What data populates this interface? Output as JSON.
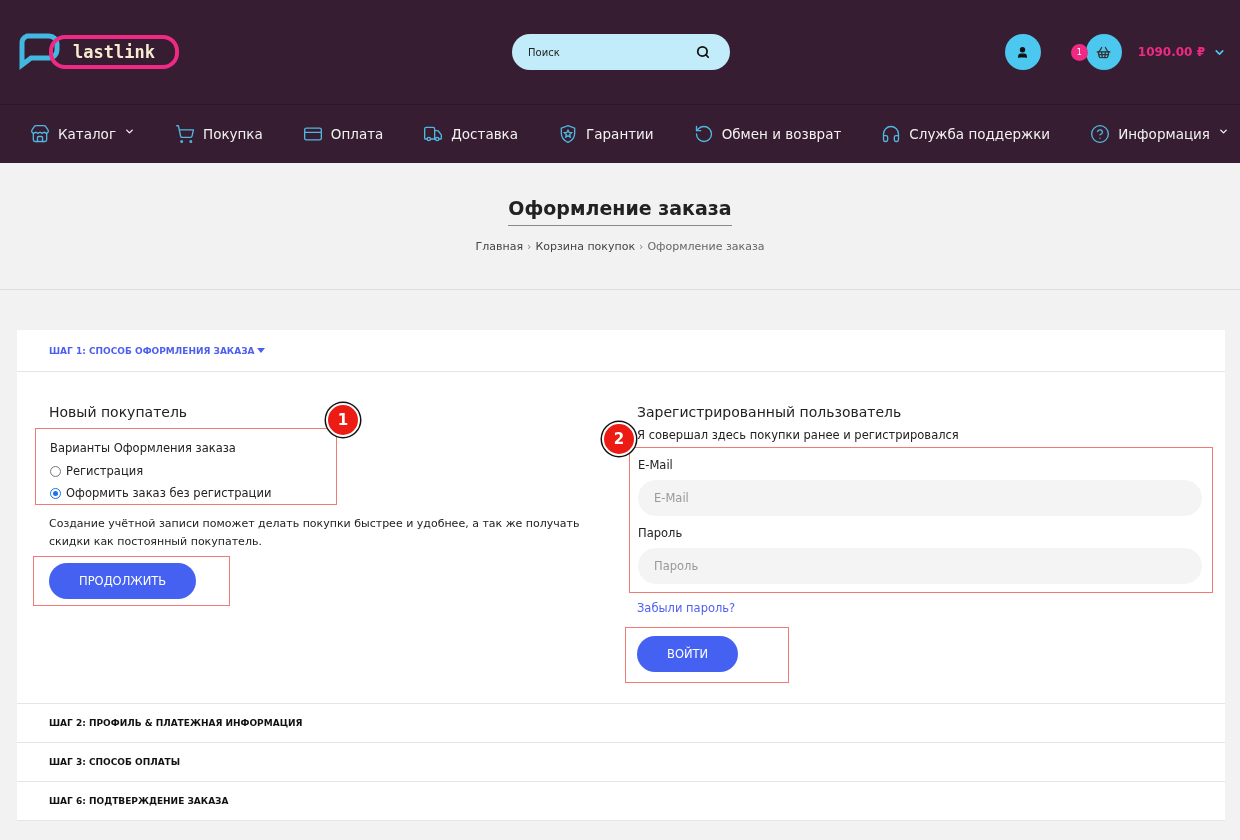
{
  "header": {
    "logo": "lastlink",
    "search": {
      "placeholder": "Поиск"
    },
    "cart": {
      "count": "1",
      "total": "1090.00 ₽"
    }
  },
  "nav": [
    {
      "label": "Каталог",
      "dropdown": true
    },
    {
      "label": "Покупка",
      "dropdown": false
    },
    {
      "label": "Оплата",
      "dropdown": false
    },
    {
      "label": "Доставка",
      "dropdown": false
    },
    {
      "label": "Гарантии",
      "dropdown": false
    },
    {
      "label": "Обмен и возврат",
      "dropdown": false
    },
    {
      "label": "Служба поддержки",
      "dropdown": false
    },
    {
      "label": "Информация",
      "dropdown": true
    }
  ],
  "page_title": "Оформление заказа",
  "breadcrumbs": [
    {
      "kind": "link",
      "text": "Главная"
    },
    {
      "kind": "separator",
      "text": "›"
    },
    {
      "kind": "link",
      "text": "Корзина покупок"
    },
    {
      "kind": "separator",
      "text": "›"
    },
    {
      "kind": "current",
      "text": "Оформление заказа"
    }
  ],
  "steps": [
    {
      "title": "ШАГ 1: СПОСОБ ОФОРМЛЕНИЯ ЗАКАЗА",
      "expanded": true
    },
    {
      "title": "ШАГ 2: ПРОФИЛЬ & ПЛАТЕЖНАЯ ИНФОРМАЦИЯ",
      "expanded": false
    },
    {
      "title": "ШАГ 3: СПОСОБ ОПЛАТЫ",
      "expanded": false
    },
    {
      "title": "ШАГ 6: ПОДТВЕРЖДЕНИЕ ЗАКАЗА",
      "expanded": false
    }
  ],
  "new_customer": {
    "heading": "Новый покупатель",
    "options_label": "Варианты Оформления заказа",
    "options": [
      {
        "label": "Регистрация",
        "selected": false
      },
      {
        "label": "Оформить заказ без регистрации",
        "selected": true
      }
    ],
    "note": "Создание учётной записи поможет делать покупки быстрее и удобнее, а так же получать скидки как постоянный покупатель.",
    "button": "ПРОДОЛЖИТЬ"
  },
  "registered": {
    "heading": "Зарегистрированный пользователь",
    "intro": "Я совершал здесь покупки ранее и регистрировался",
    "fields": [
      {
        "label": "E-Mail",
        "placeholder": "E-Mail"
      },
      {
        "label": "Пароль",
        "placeholder": "Пароль"
      }
    ],
    "forgot": "Забыли пароль?",
    "button": "ВОЙТИ"
  },
  "annotations": [
    "1",
    "2"
  ]
}
